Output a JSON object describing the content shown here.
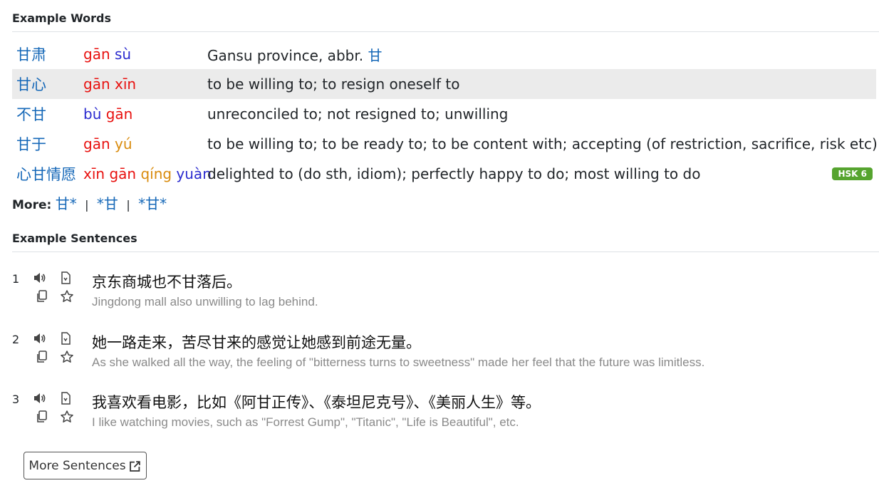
{
  "words_section": {
    "title": "Example Words",
    "rows": [
      {
        "hanzi": "甘肃",
        "pinyin": [
          {
            "s": "gān",
            "t": "t1"
          },
          {
            "s": " ",
            "t": ""
          },
          {
            "s": "sù",
            "t": "t4"
          }
        ],
        "def_text": "Gansu province, abbr. ",
        "def_link": "甘",
        "hsk": ""
      },
      {
        "hanzi": "甘心",
        "pinyin": [
          {
            "s": "gān",
            "t": "t1"
          },
          {
            "s": " ",
            "t": ""
          },
          {
            "s": "xīn",
            "t": "t1"
          }
        ],
        "def_text": "to be willing to; to resign oneself to",
        "def_link": "",
        "hsk": ""
      },
      {
        "hanzi": "不甘",
        "pinyin": [
          {
            "s": "bù",
            "t": "t4"
          },
          {
            "s": " ",
            "t": ""
          },
          {
            "s": "gān",
            "t": "t1"
          }
        ],
        "def_text": "unreconciled to; not resigned to; unwilling",
        "def_link": "",
        "hsk": ""
      },
      {
        "hanzi": "甘于",
        "pinyin": [
          {
            "s": "gān",
            "t": "t1"
          },
          {
            "s": " ",
            "t": ""
          },
          {
            "s": "yú",
            "t": "t2"
          }
        ],
        "def_text": "to be willing to; to be ready to; to be content with; accepting (of restriction, sacrifice, risk etc)",
        "def_link": "",
        "hsk": ""
      },
      {
        "hanzi": "心甘情愿",
        "pinyin": [
          {
            "s": "xīn",
            "t": "t1"
          },
          {
            "s": " ",
            "t": ""
          },
          {
            "s": "gān",
            "t": "t1"
          },
          {
            "s": " ",
            "t": ""
          },
          {
            "s": "qíng",
            "t": "t2"
          },
          {
            "s": " ",
            "t": ""
          },
          {
            "s": "yuàn",
            "t": "t4"
          }
        ],
        "def_text": "delighted to (do sth, idiom); perfectly happy to do; most willing to do",
        "def_link": "",
        "hsk": "HSK 6"
      }
    ],
    "more_label": "More:",
    "more_links": [
      "甘*",
      "*甘",
      "*甘*"
    ],
    "more_sep": "|"
  },
  "sentences_section": {
    "title": "Example Sentences",
    "items": [
      {
        "num": "1",
        "zh": "京东商城也不甘落后。",
        "en": "Jingdong mall also unwilling to lag behind."
      },
      {
        "num": "2",
        "zh": "她一路走来，苦尽甘来的感觉让她感到前途无量。",
        "en": "As she walked all the way, the feeling of \"bitterness turns to sweetness\" made her feel that the future was limitless."
      },
      {
        "num": "3",
        "zh": "我喜欢看电影，比如《阿甘正传》、《泰坦尼克号》、《美丽人生》等。",
        "en": "I like watching movies, such as \"Forrest Gump\", \"Titanic\", \"Life is Beautiful\", etc."
      }
    ],
    "more_button": "More Sentences"
  },
  "colors": {
    "link": "#1668b8",
    "tone1": "#e8110f",
    "tone2": "#d98b0d",
    "tone4": "#2b2bcf",
    "hsk_badge": "#56a42f",
    "row_highlight": "#ebebeb"
  },
  "icons": [
    "speaker-icon",
    "document-icon",
    "copy-icon",
    "star-icon",
    "external-link-icon"
  ]
}
